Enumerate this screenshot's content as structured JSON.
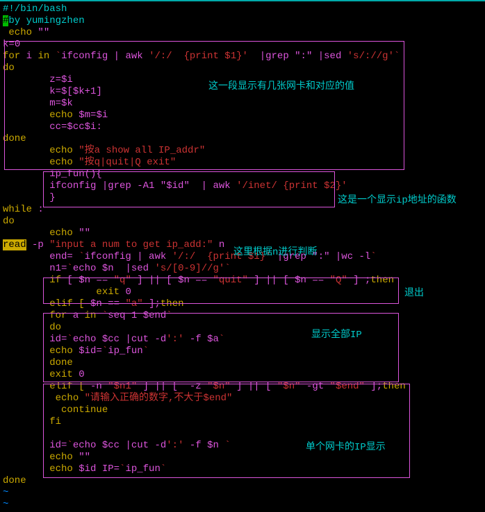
{
  "header": {
    "shebang": "#!/bin/bash",
    "byline_hash": "#",
    "byline": "by yumingzhen",
    "echo1_kw": " echo ",
    "echo1_str": "\"\""
  },
  "block1": {
    "kinit": "k=",
    "kval": "0",
    "for": "for",
    "i": " i ",
    "in": "in",
    "tick": " `",
    "ifconfig": "ifconfig | ",
    "awk": "awk ",
    "awk_arg": "'/:/  {print $1}'",
    "awk_grep": " |grep ",
    "colon": "\":\" ",
    "sed": "|sed ",
    "sed_arg": "'s/://g'",
    "tick2": "`",
    "do": "do",
    "l1a": "        z=",
    "l1b": "$i",
    "l2a": "        k=$[",
    "l2b": "$k+1",
    "l2c": "]",
    "l3a": "        m=",
    "l3b": "$k",
    "l4a": "        echo ",
    "l4m": "$m",
    "l4eq": "=",
    "l4i": "$i",
    "l5a": "        cc=",
    "l5c": "$cc",
    "l5i": "$i",
    "l5colon": ":",
    "done": "done",
    "echo_a1": "        echo ",
    "msg_a": "\"按a show all IP_addr\"",
    "echo_q1": "        echo ",
    "msg_q": "\"按q|quit|Q exit\""
  },
  "fun": {
    "name": "        ip_fun(){",
    "body1": "        ifconfig |grep -A1 ",
    "id": "\"$id\"",
    "pipe": "  | awk ",
    "awk_arg": "'/inet/ {print $2}'",
    "close": "        }"
  },
  "loop": {
    "while": "while ",
    "colon": ":",
    "do": "do",
    "echo1": "        echo ",
    "echo1_str": "\"\"",
    "read": "read",
    "read_p": " -p ",
    "prompt": "\"input a num to get ip_add:\"",
    "read_var": " n",
    "end_assign": "        end= ",
    "end_tick": "`",
    "end_cmd1": "ifconfig | ",
    "end_awk": "awk ",
    "end_awk_arg": "'/:/  {print $1}'",
    "end_grep": " |grep ",
    "end_colon": "\":\" ",
    "end_wc": "|wc -l",
    "end_tick2": "`",
    "n1_assign": "        n1=",
    "n1_tick": "`",
    "n1_echo": "echo ",
    "n1_var": "$n ",
    "n1_sed": " |sed ",
    "n1_arg": "'s/[0-9]//g'",
    "n1_tick2": "`"
  },
  "cond1": {
    "if1": "        if ",
    "br1": "[ ",
    "n": "$n",
    "eq": " == ",
    "q": "\"q\"",
    "br2": " ] || [ ",
    "quit": "\"quit\"",
    "br3": " ] || [ ",
    "Q": "\"Q\"",
    "br4": " ] ;",
    "then": "then",
    "exit": "                exit ",
    "zero": "0"
  },
  "cond2": {
    "elif": "        elif [ ",
    "n": "$n",
    "eq": " == ",
    "a": "\"a\"",
    "br": " ];",
    "then": "then"
  },
  "block4": {
    "for": "        for",
    "a": " a ",
    "in": "in ",
    "tick": "`",
    "seq": "seq 1 ",
    "end": "$end",
    "tick2": "`",
    "do": "        do",
    "id": "        id=",
    "id_tick": "`",
    "id_echo": "echo ",
    "cc": "$cc ",
    "cut": "|cut -d",
    "cut_d": "':'",
    "cut_f": " -f ",
    "a_var": "$a",
    "id_tick2": "`",
    "echo_id": "        echo ",
    "id_var": "$id",
    "eq": "=",
    "fn_tick": "`",
    "fn": "ip_fun",
    "fn_tick2": "`",
    "done": "        done",
    "exit": "        exit ",
    "zero": "0"
  },
  "block5": {
    "elif": "        elif [ ",
    "neg_n": "-n ",
    "n1": "\"$n1\"",
    "br": " ] || [ ",
    "neg_z": " -z ",
    "n": "\"$n\"",
    "br2": " ] || [ ",
    "n_raw": "\"$n\"",
    "gt": " -gt ",
    "end": "\"$end\"",
    "br3": " ];",
    "then": "then",
    "echo": "         echo ",
    "msg": "\"请输入正确的数字,不大于$end\"",
    "cont": "          continue",
    "fi": "        fi",
    "id": "        id=",
    "tick": "`",
    "echo2": "echo ",
    "cc": "$cc ",
    "cut": "|cut -d",
    "cut_d": "':'",
    "cut_f": " -f ",
    "n_var": "$n ",
    "tick2": "`",
    "echo3": "        echo ",
    "str": "\"\"",
    "echo4": "        echo ",
    "id_var": "$id",
    "ip": " IP=",
    "fn_tick": "`",
    "fn": "ip_fun",
    "fn_tick2": "`"
  },
  "footer": {
    "done": "done",
    "t1": "~",
    "t2": "~"
  },
  "annotations": {
    "a1": "这一段显示有几张网卡和对应的值",
    "a2": "这是一个显示ip地址的函数",
    "a3": "这里根据n进行判断",
    "a4": "退出",
    "a5": "显示全部IP",
    "a6": "单个网卡的IP显示"
  }
}
